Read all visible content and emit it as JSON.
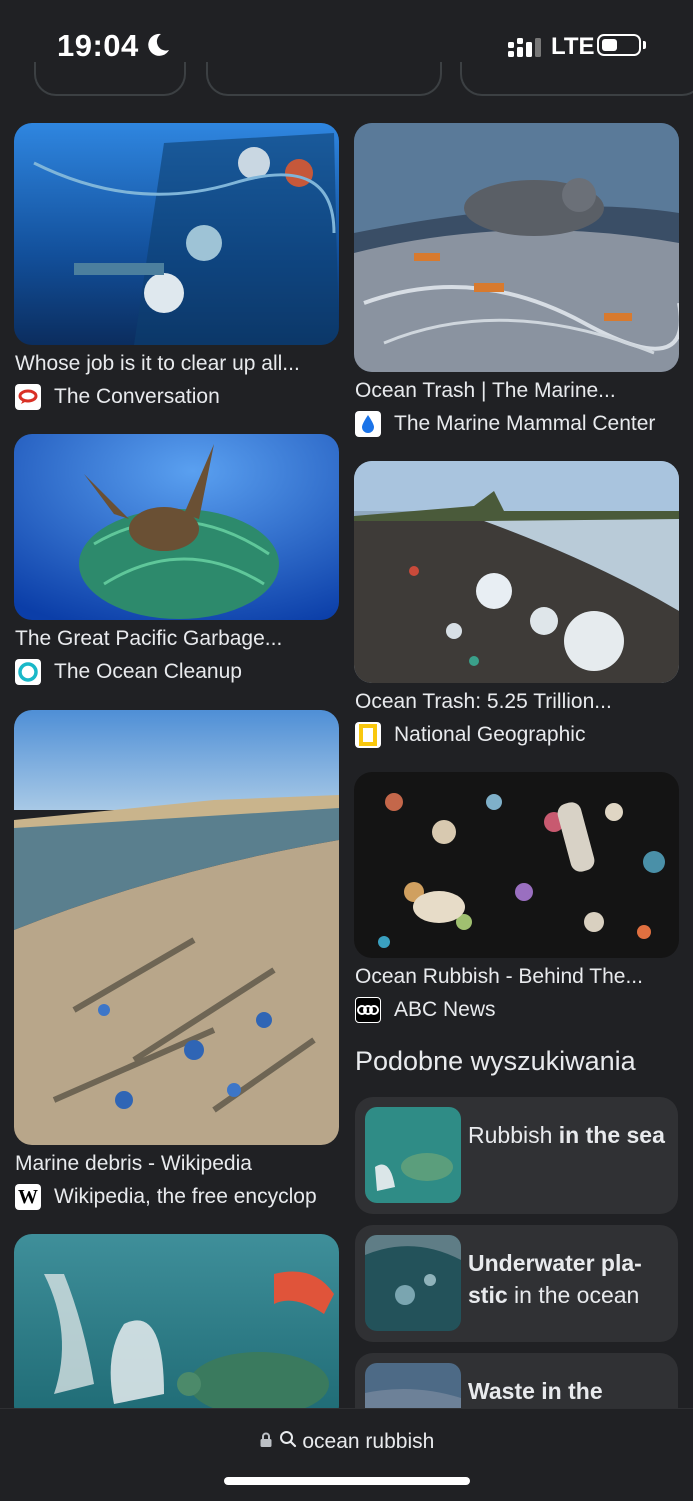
{
  "status": {
    "time": "19:04",
    "network": "LTE",
    "battery_level": 0.35
  },
  "results": [
    {
      "title": "Whose job is it to clear up all...",
      "source": "The Conversation",
      "favicon": "conversation-icon",
      "accent": "#d93025"
    },
    {
      "title": "Ocean Trash | The Marine...",
      "source": "The Marine Mammal Center",
      "favicon": "droplet-icon",
      "accent": "#1a73e8"
    },
    {
      "title": "The Great Pacific Garbage...",
      "source": "The Ocean Cleanup",
      "favicon": "ring-icon",
      "accent": "#19b8c8"
    },
    {
      "title": "Ocean Trash: 5.25 Trillion...",
      "source": "National Geographic",
      "favicon": "yellow-frame-icon",
      "accent": "#f9c80e"
    },
    {
      "title": "Marine debris - Wikipedia",
      "source": "Wikipedia, the free encyclop",
      "favicon": "wikipedia-icon",
      "accent": "#ffffff"
    },
    {
      "title": "Ocean Rubbish - Behind The...",
      "source": "ABC News",
      "favicon": "abc-icon",
      "accent": "#ffffff"
    }
  ],
  "related": {
    "heading": "Podobne wyszukiwania",
    "items": [
      {
        "prefix": "Rubbish",
        "bold": " in the sea",
        "suffix": ""
      },
      {
        "prefix": "",
        "bold": "Underwater pla-stic",
        "suffix": " in the ocean"
      },
      {
        "prefix": "",
        "bold": "Waste in the",
        "suffix": ""
      }
    ]
  },
  "address_bar": {
    "query": "ocean rubbish"
  }
}
